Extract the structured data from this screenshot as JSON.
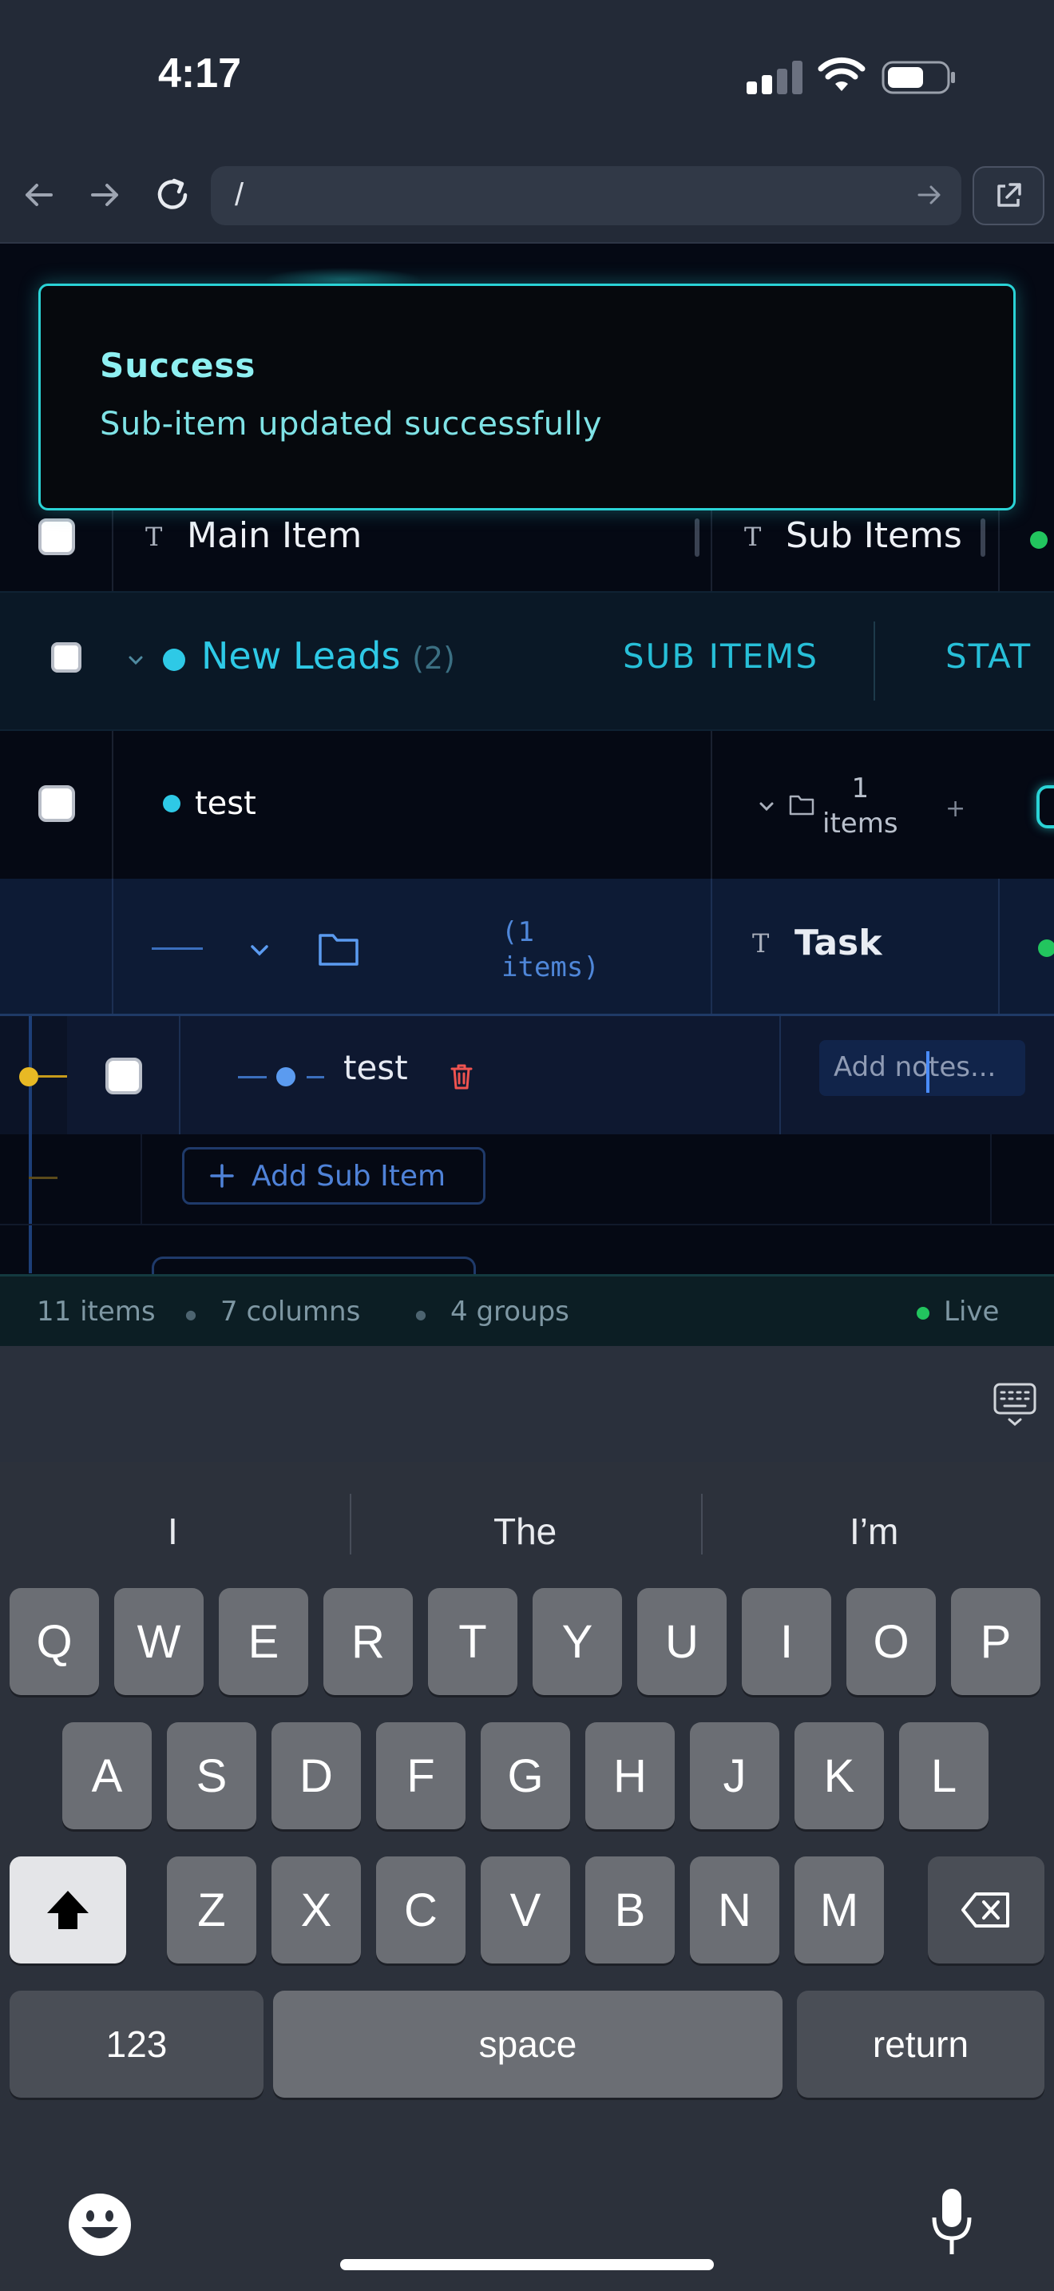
{
  "status": {
    "time": "4:17"
  },
  "browser": {
    "url": "/"
  },
  "toast": {
    "title": "Success",
    "message": "Sub-item updated successfully"
  },
  "table": {
    "columns": {
      "main": "Main Item",
      "sub": "Sub Items"
    },
    "group": {
      "name": "New Leads",
      "count": "(2)",
      "col_sub": "SUB ITEMS",
      "col_status": "STAT"
    },
    "item": {
      "name": "test",
      "count_num": "1",
      "count_label": "items",
      "plus": "+"
    },
    "sub_header": {
      "items_line1": "(1",
      "items_line2": "items)",
      "task": "Task"
    },
    "sub_item": {
      "name": "test",
      "notes_placeholder": "Add notes..."
    },
    "add_sub_item": "Add Sub Item"
  },
  "footer": {
    "items": "11 items",
    "columns": "7 columns",
    "groups": "4 groups",
    "live": "Live"
  },
  "keyboard": {
    "suggestions": [
      "I",
      "The",
      "I’m"
    ],
    "row1": [
      "Q",
      "W",
      "E",
      "R",
      "T",
      "Y",
      "U",
      "I",
      "O",
      "P"
    ],
    "row2": [
      "A",
      "S",
      "D",
      "F",
      "G",
      "H",
      "J",
      "K",
      "L"
    ],
    "row3": [
      "Z",
      "X",
      "C",
      "V",
      "B",
      "N",
      "M"
    ],
    "numbers": "123",
    "space": "space",
    "return": "return"
  },
  "colors": {
    "accent": "#2ad3d6",
    "group": "#2ec9e6",
    "sub": "#4f82d8",
    "live": "#22c55e"
  }
}
